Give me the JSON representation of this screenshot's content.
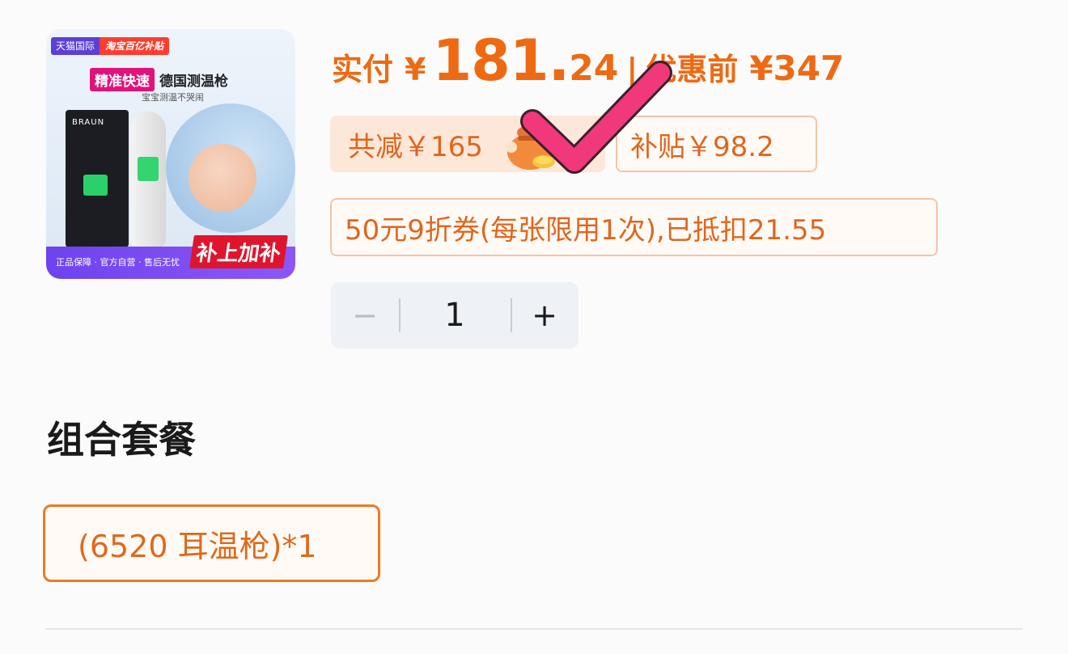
{
  "product": {
    "image": {
      "badge_tmall": "天猫国际",
      "badge_taobao": "淘宝百亿补贴",
      "tag_pink": "精准快速",
      "tag_title": "德国测温枪",
      "subtitle": "宝宝测温不哭闹",
      "box_brand": "BRAUN",
      "guarantee": "正品保障 · 官方自营 · 售后无忧",
      "bonus": "补上加补"
    }
  },
  "price": {
    "actual_label": "实付",
    "currency": "¥",
    "actual_int": "181.",
    "actual_dec": "24",
    "separator": "|",
    "before_label": "优惠前",
    "before_value": "¥347"
  },
  "discounts": {
    "total_reduce": "共减￥165",
    "subsidy": "补贴￥98.2",
    "coupon": "50元9折券(每张限用1次),已抵扣21.55"
  },
  "stepper": {
    "minus": "−",
    "quantity": "1",
    "plus": "+"
  },
  "bundle": {
    "section_title": "组合套餐",
    "option": "(6520 耳温枪)*1"
  },
  "colors": {
    "accent": "#ee6a12",
    "chip_bg": "#fde7d8",
    "check": "#f0387a"
  }
}
